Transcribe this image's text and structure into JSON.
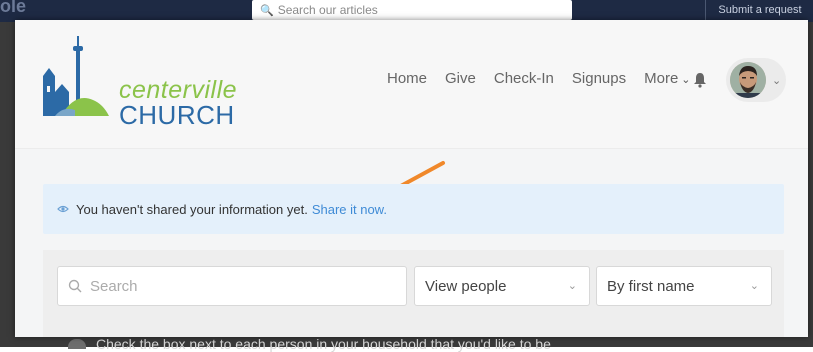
{
  "background": {
    "brand_fragment": "ole",
    "search_placeholder": "Search our articles",
    "submit_label": "Submit a request",
    "partial_text": "Check the box next to each person in your household that you'd like to be"
  },
  "logo": {
    "line1": "centerville",
    "line2": "CHURCH"
  },
  "nav": {
    "items": [
      "Home",
      "Give",
      "Check-In",
      "Signups",
      "More"
    ]
  },
  "alert": {
    "message": "You haven't shared your information yet.",
    "link": "Share it now."
  },
  "filters": {
    "search_placeholder": "Search",
    "view_select": "View people",
    "sort_select": "By first name"
  },
  "colors": {
    "accent_blue": "#3f8bd6",
    "logo_green": "#8bc34a",
    "logo_blue": "#2c6aa6",
    "arrow_orange": "#f0882a",
    "alert_bg": "#e4f0fb"
  }
}
